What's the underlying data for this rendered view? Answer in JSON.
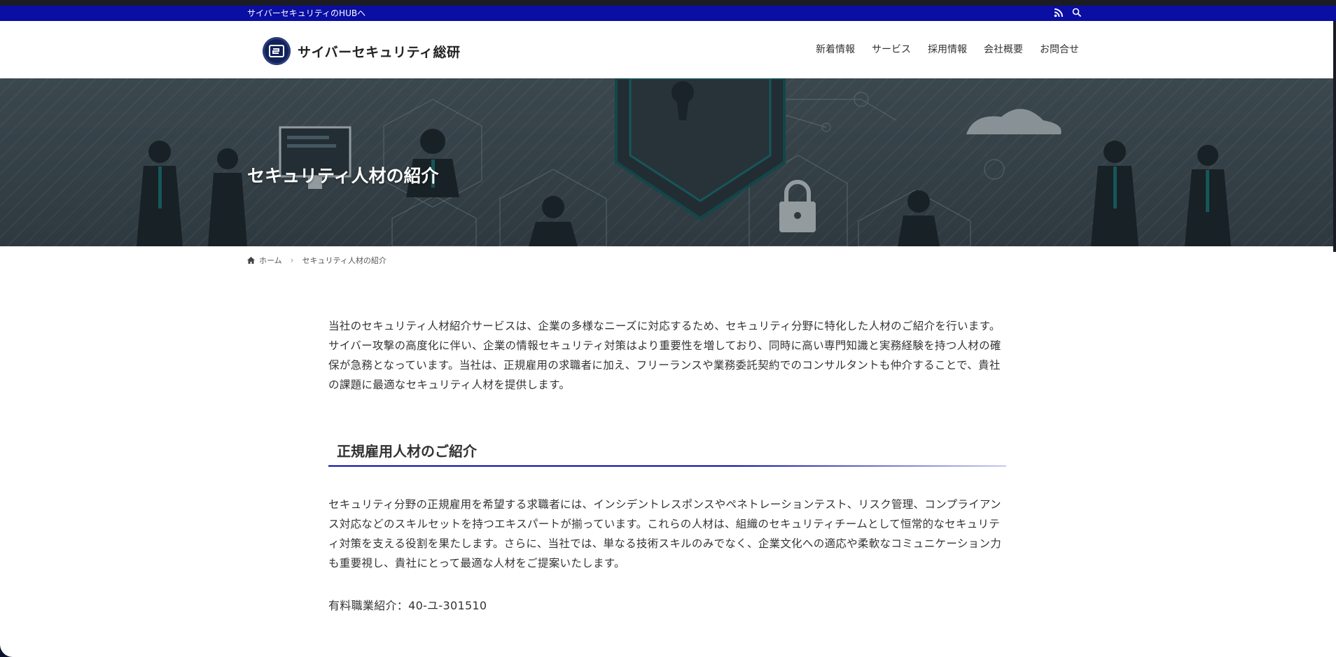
{
  "topbar": {
    "hub_link": "サイバーセキュリティのHUBへ",
    "icons": [
      "rss-icon",
      "search-icon"
    ]
  },
  "header": {
    "logo_text": "サイバーセキュリティ総研",
    "nav": [
      "新着情報",
      "サービス",
      "採用情報",
      "会社概要",
      "お問合せ"
    ]
  },
  "hero": {
    "title": "セキュリティ人材の紹介"
  },
  "breadcrumb": {
    "home": "ホーム",
    "current": "セキュリティ人材の紹介"
  },
  "content": {
    "intro": "当社のセキュリティ人材紹介サービスは、企業の多様なニーズに対応するため、セキュリティ分野に特化した人材のご紹介を行います。サイバー攻撃の高度化に伴い、企業の情報セキュリティ対策はより重要性を増しており、同時に高い専門知識と実務経験を持つ人材の確保が急務となっています。当社は、正規雇用の求職者に加え、フリーランスや業務委託契約でのコンサルタントも仲介することで、貴社の課題に最適なセキュリティ人材を提供します。",
    "section_heading": "正規雇用人材のご紹介",
    "section_body": "セキュリティ分野の正規雇用を希望する求職者には、インシデントレスポンスやペネトレーションテスト、リスク管理、コンプライアンス対応などのスキルセットを持つエキスパートが揃っています。これらの人材は、組織のセキュリティチームとして恒常的なセキュリティ対策を支える役割を果たします。さらに、当社では、単なる技術スキルのみでなく、企業文化への適応や柔軟なコミュニケーション力も重要視し、貴社にとって最適な人材をご提案いたします。",
    "license": "有料職業紹介：40-ユ-301510"
  },
  "colors": {
    "brand_blue": "#0a0ea3",
    "text": "#333333",
    "hero_overlay": "#3a464c"
  }
}
